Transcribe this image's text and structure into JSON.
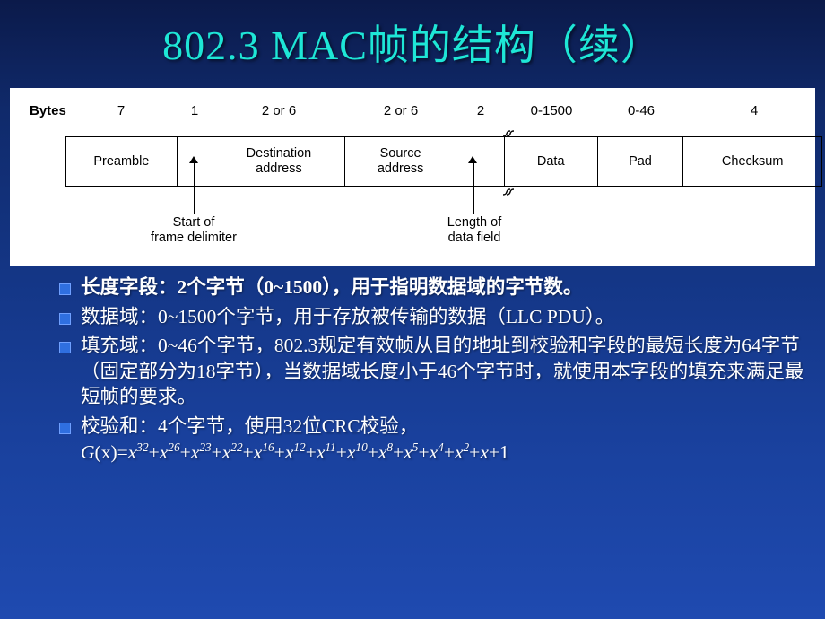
{
  "slide": {
    "title": "802.3 MAC帧的结构（续）",
    "title_color": "#1ee6d6"
  },
  "figure": {
    "bytes_label": "Bytes",
    "byte_counts": [
      "7",
      "1",
      "2 or 6",
      "2 or 6",
      "2",
      "0-1500",
      "0-46",
      "4"
    ],
    "fields": [
      {
        "name": "Preamble"
      },
      {
        "name": ""
      },
      {
        "name": "Destination\naddress"
      },
      {
        "name": "Source\naddress"
      },
      {
        "name": ""
      },
      {
        "name": "Data"
      },
      {
        "name": "Pad"
      },
      {
        "name": "Checksum"
      }
    ],
    "field_labels": {
      "preamble": "Preamble",
      "sfd": "",
      "destination": "Destination address",
      "source": "Source address",
      "length": "",
      "data": "Data",
      "pad": "Pad",
      "checksum": "Checksum"
    },
    "callouts": [
      "Start of\nframe delimiter",
      "Length of\ndata field"
    ],
    "callout_1_line1": "Start of",
    "callout_1_line2": "frame delimiter",
    "callout_2_line1": "Length of",
    "callout_2_line2": "data field",
    "dest_line1": "Destination",
    "dest_line2": "address",
    "src_line1": "Source",
    "src_line2": "address"
  },
  "bullets": [
    {
      "text": "长度字段：2个字节（0~1500），用于指明数据域的字节数。"
    },
    {
      "text": "数据域：0~1500个字节，用于存放被传输的数据（LLC PDU）。"
    },
    {
      "text": "填充域：0~46个字节，802.3规定有效帧从目的地址到校验和字段的最短长度为64字节（固定部分为18字节），当数据域长度小于46个字节时，就使用本字段的填充来满足最短帧的要求。"
    },
    {
      "text": "校验和：4个字节，使用32位CRC校验，"
    }
  ],
  "formula": {
    "lead": "G",
    "open": "(x)=",
    "terms": [
      "x32",
      "x26",
      "x23",
      "x22",
      "x16",
      "x12",
      "x11",
      "x10",
      "x8",
      "x5",
      "x4",
      "x2",
      "x",
      "1"
    ],
    "plain": "G(x)=x32+x26+x23+x22+x16+x12+x11+x10+x8+x5+x4+x2+x+1"
  }
}
